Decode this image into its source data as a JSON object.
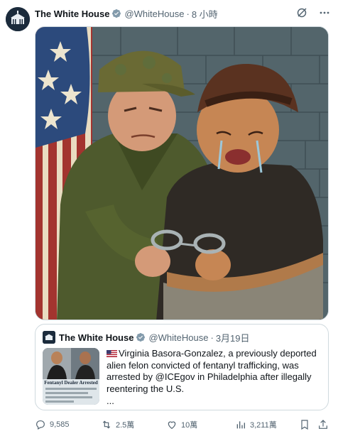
{
  "post": {
    "author_name": "The White House",
    "handle": "@WhiteHouse",
    "separator": "·",
    "time": "8 小時"
  },
  "media": {
    "kind": "illustration"
  },
  "quote": {
    "author_name": "The White House",
    "handle": "@WhiteHouse",
    "separator": "·",
    "date": "3月19日",
    "text": "Virginia Basora-Gonzalez, a previously deported alien felon convicted of fentanyl trafficking, was arrested by @ICEgov in Philadelphia after illegally reentering the U.S.",
    "ellipsis": "...",
    "thumb_caption": "Fentanyl Dealer Arrested"
  },
  "actions": {
    "replies": "9,585",
    "reposts": "2.5萬",
    "likes": "10萬",
    "views": "3,211萬"
  },
  "colors": {
    "text_primary": "#0f1419",
    "text_secondary": "#536471",
    "verified": "#829aab",
    "border": "#cfd9de"
  }
}
